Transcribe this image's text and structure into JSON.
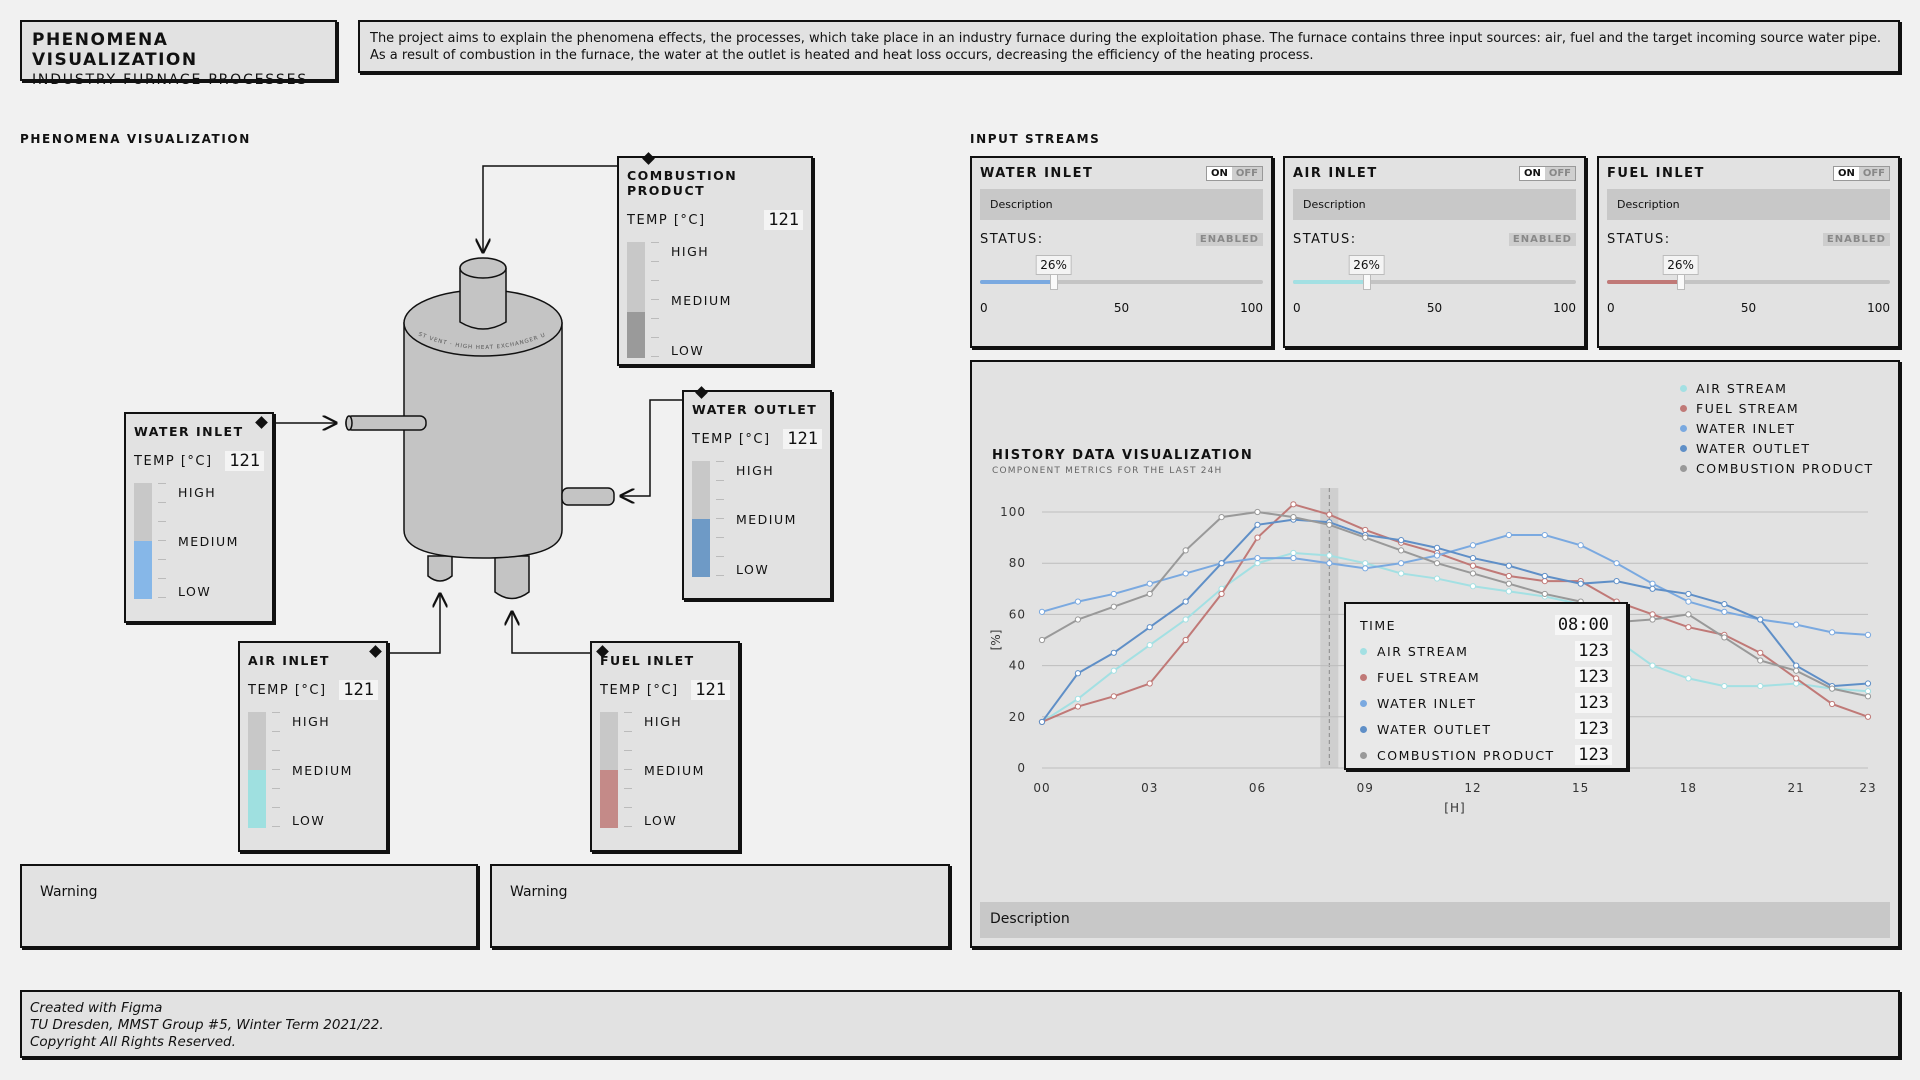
{
  "header": {
    "title": "PHENOMENA VISUALIZATION",
    "subtitle": "INDUSTRY FURNACE PROCESSES",
    "intro": "The project aims to explain the phenomena effects, the processes, which take place in an industry furnace during the exploitation phase. The furnace contains three input sources: air, fuel and the target incoming source water pipe. As a result of combustion in the furnace, the water at the outlet is heated and heat loss occurs, decreasing the efficiency of the heating process."
  },
  "phenomena": {
    "section_title": "PHENOMENA VISUALIZATION",
    "furnace_ring_text": "DUST VENT · HIGH HEAT EXCHANGER UNIT",
    "levels": {
      "high": "HIGH",
      "medium": "MEDIUM",
      "low": "LOW"
    },
    "temp_label": "TEMP [°C]",
    "cards": {
      "combustion": {
        "title": "COMBUSTION PRODUCT",
        "temp": "121",
        "fill_pct": 40,
        "color": "#9a9a9a"
      },
      "water_outlet": {
        "title": "WATER OUTLET",
        "temp": "121",
        "fill_pct": 50,
        "color": "#6e9ac6"
      },
      "water_inlet": {
        "title": "WATER INLET",
        "temp": "121",
        "fill_pct": 50,
        "color": "#86b7e8"
      },
      "air_inlet": {
        "title": "AIR INLET",
        "temp": "121",
        "fill_pct": 50,
        "color": "#9fe0e0"
      },
      "fuel_inlet": {
        "title": "FUEL INLET",
        "temp": "121",
        "fill_pct": 50,
        "color": "#c48a88"
      }
    },
    "warnings": [
      "Warning",
      "Warning"
    ]
  },
  "input_streams": {
    "section_title": "INPUT STREAMS",
    "status_label": "STATUS:",
    "toggle_on": "ON",
    "toggle_off": "OFF",
    "scale": [
      "0",
      "50",
      "100"
    ],
    "streams": [
      {
        "title": "WATER INLET",
        "description": "Description",
        "status": "ENABLED",
        "value": 26,
        "value_label": "26%",
        "color": "#7aa9e0"
      },
      {
        "title": "AIR INLET",
        "description": "Description",
        "status": "ENABLED",
        "value": 26,
        "value_label": "26%",
        "color": "#a3e0e3"
      },
      {
        "title": "FUEL INLET",
        "description": "Description",
        "status": "ENABLED",
        "value": 26,
        "value_label": "26%",
        "color": "#c07977"
      }
    ]
  },
  "history": {
    "title": "HISTORY DATA VISUALIZATION",
    "subtitle": "COMPONENT METRICS FOR THE LAST 24H",
    "description": "Description",
    "tooltip": {
      "time_label": "TIME",
      "time_value": "08:00",
      "rows": [
        {
          "name": "AIR STREAM",
          "value": "123"
        },
        {
          "name": "FUEL STREAM",
          "value": "123"
        },
        {
          "name": "WATER INLET",
          "value": "123"
        },
        {
          "name": "WATER OUTLET",
          "value": "123"
        },
        {
          "name": "COMBUSTION PRODUCT",
          "value": "123"
        }
      ]
    }
  },
  "chart_data": {
    "type": "line",
    "title": "HISTORY DATA VISUALIZATION",
    "subtitle": "COMPONENT METRICS FOR THE LAST 24H",
    "xlabel": "[H]",
    "ylabel": "[%]",
    "xlim": [
      0,
      23
    ],
    "ylim": [
      0,
      100
    ],
    "x_ticks": [
      "00",
      "03",
      "06",
      "09",
      "12",
      "15",
      "18",
      "21",
      "23"
    ],
    "x_tick_values": [
      0,
      3,
      6,
      9,
      12,
      15,
      18,
      21,
      23
    ],
    "y_ticks": [
      0,
      20,
      40,
      60,
      80,
      100
    ],
    "grid": true,
    "legend_position": "top-right",
    "highlight_x": 8,
    "x": [
      0,
      1,
      2,
      3,
      4,
      5,
      6,
      7,
      8,
      9,
      10,
      11,
      12,
      13,
      14,
      15,
      16,
      17,
      18,
      19,
      20,
      21,
      22,
      23
    ],
    "series": [
      {
        "name": "AIR STREAM",
        "color": "#a3e0e3",
        "values": [
          18,
          27,
          38,
          48,
          58,
          70,
          80,
          84,
          83,
          80,
          76,
          74,
          71,
          69,
          67,
          64,
          50,
          40,
          35,
          32,
          32,
          33,
          31,
          30
        ]
      },
      {
        "name": "FUEL STREAM",
        "color": "#c07977",
        "values": [
          18,
          24,
          28,
          33,
          50,
          68,
          90,
          103,
          99,
          93,
          88,
          84,
          79,
          75,
          73,
          73,
          65,
          60,
          55,
          52,
          45,
          35,
          25,
          20
        ]
      },
      {
        "name": "WATER INLET",
        "color": "#7aa9e0",
        "values": [
          61,
          65,
          68,
          72,
          76,
          80,
          82,
          82,
          80,
          78,
          80,
          83,
          87,
          91,
          91,
          87,
          80,
          72,
          65,
          61,
          58,
          56,
          53,
          52
        ]
      },
      {
        "name": "WATER OUTLET",
        "color": "#5f8fc7",
        "values": [
          18,
          37,
          45,
          55,
          65,
          80,
          95,
          97,
          96,
          91,
          89,
          86,
          82,
          79,
          75,
          72,
          73,
          70,
          68,
          64,
          58,
          40,
          32,
          33
        ]
      },
      {
        "name": "COMBUSTION PRODUCT",
        "color": "#999999",
        "values": [
          50,
          58,
          63,
          68,
          85,
          98,
          100,
          98,
          95,
          90,
          85,
          80,
          76,
          72,
          68,
          65,
          57,
          58,
          60,
          51,
          42,
          38,
          31,
          28
        ]
      }
    ]
  },
  "footer": {
    "lines": [
      "Created with Figma",
      "TU Dresden, MMST Group #5, Winter Term 2021/22.",
      "Copyright All Rights Reserved."
    ]
  }
}
